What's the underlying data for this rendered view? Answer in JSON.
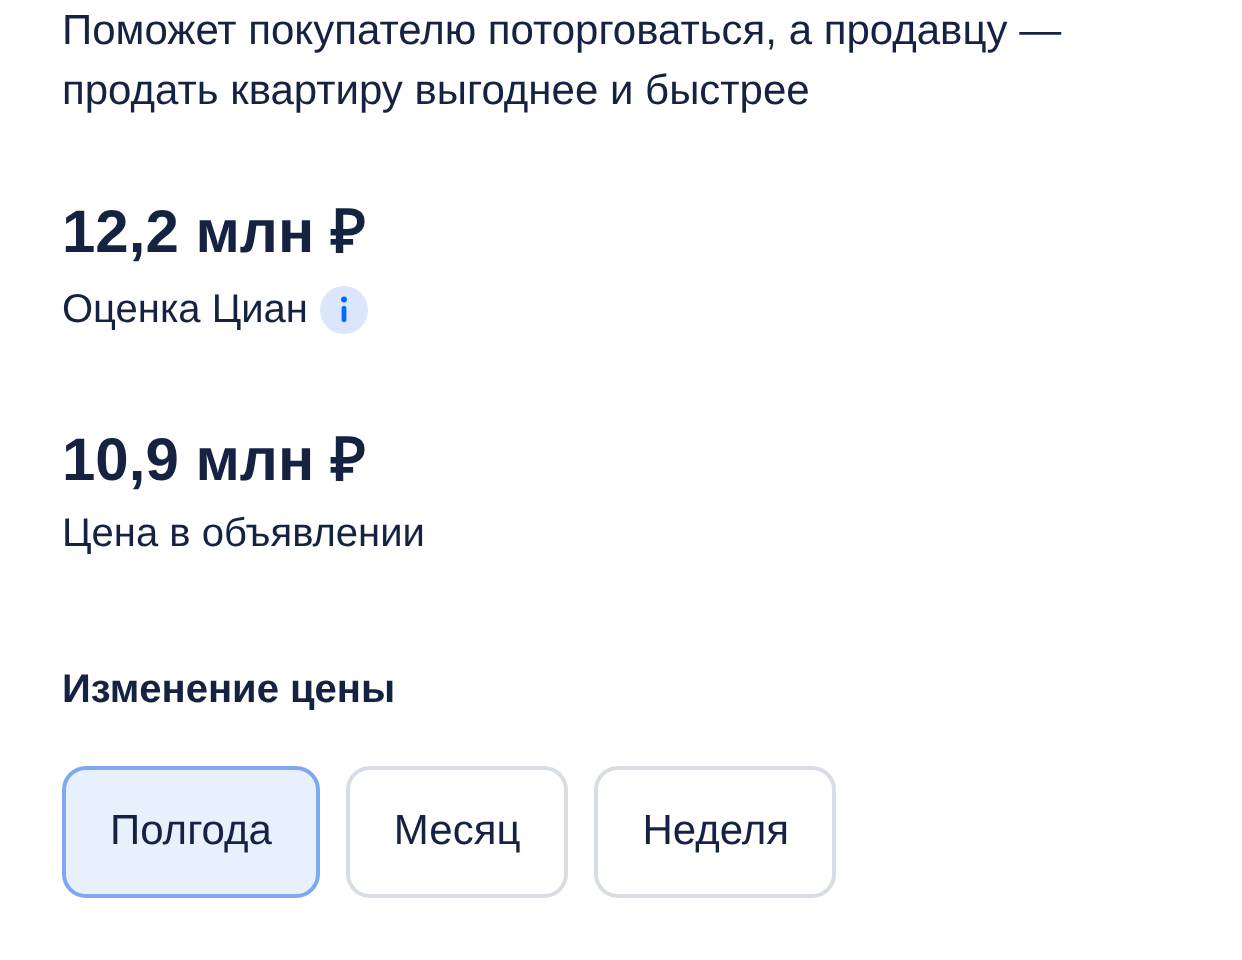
{
  "description": "Поможет покупателю поторговаться, а продавцу — продать квартиру выгоднее и быстрее",
  "estimate": {
    "value": "12,2 млн ₽",
    "label": "Оценка Циан"
  },
  "listing": {
    "value": "10,9 млн ₽",
    "label": "Цена в объявлении"
  },
  "price_change": {
    "title": "Изменение цены",
    "periods": [
      {
        "label": "Полгода",
        "selected": true
      },
      {
        "label": "Месяц",
        "selected": false
      },
      {
        "label": "Неделя",
        "selected": false
      }
    ]
  }
}
